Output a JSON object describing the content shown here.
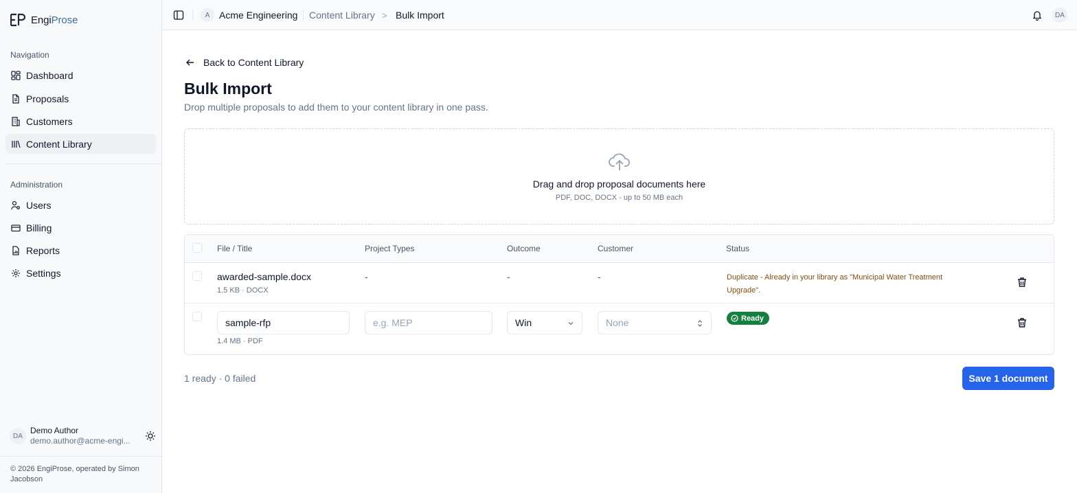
{
  "brand": {
    "prefix": "Engi",
    "suffix": "Prose"
  },
  "sidebar": {
    "nav_label": "Navigation",
    "nav_items": [
      {
        "label": "Dashboard",
        "icon": "dashboard-icon"
      },
      {
        "label": "Proposals",
        "icon": "file-text-icon"
      },
      {
        "label": "Customers",
        "icon": "building-icon"
      },
      {
        "label": "Content Library",
        "icon": "library-icon",
        "active": true
      }
    ],
    "admin_label": "Administration",
    "admin_items": [
      {
        "label": "Users",
        "icon": "user-cog-icon"
      },
      {
        "label": "Billing",
        "icon": "credit-card-icon"
      },
      {
        "label": "Reports",
        "icon": "report-icon"
      },
      {
        "label": "Settings",
        "icon": "gear-icon"
      }
    ],
    "user": {
      "initials": "DA",
      "name": "Demo Author",
      "email": "demo.author@acme-engi..."
    },
    "footer": "© 2026 EngiProse, operated by Simon Jacobson"
  },
  "topbar": {
    "org_initial": "A",
    "org_name": "Acme Engineering",
    "breadcrumb_parent": "Content Library",
    "breadcrumb_sep": ">",
    "breadcrumb_current": "Bulk Import",
    "user_initials": "DA"
  },
  "page": {
    "back_label": "Back to Content Library",
    "title": "Bulk Import",
    "subtitle": "Drop multiple proposals to add them to your content library in one pass."
  },
  "dropzone": {
    "title": "Drag and drop proposal documents here",
    "hint": "PDF, DOC, DOCX - up to 50 MB each"
  },
  "table": {
    "columns": [
      "File / Title",
      "Project Types",
      "Outcome",
      "Customer",
      "Status"
    ],
    "rows": [
      {
        "file": "awarded-sample.docx",
        "meta": "1.5 KB · DOCX",
        "project_types": "-",
        "outcome": "-",
        "customer": "-",
        "status": "Duplicate - Already in your library as \"Municipal Water Treatment Upgrade\"."
      },
      {
        "title_value": "sample-rfp",
        "meta": "1.4 MB · PDF",
        "project_types_placeholder": "e.g. MEP",
        "outcome": "Win",
        "customer": "None",
        "status": "Ready"
      }
    ]
  },
  "summary": "1 ready · 0 failed",
  "save_label": "Save 1 document",
  "colors": {
    "primary": "#2563eb",
    "success": "#15803d",
    "warning_text": "#854d0e"
  }
}
